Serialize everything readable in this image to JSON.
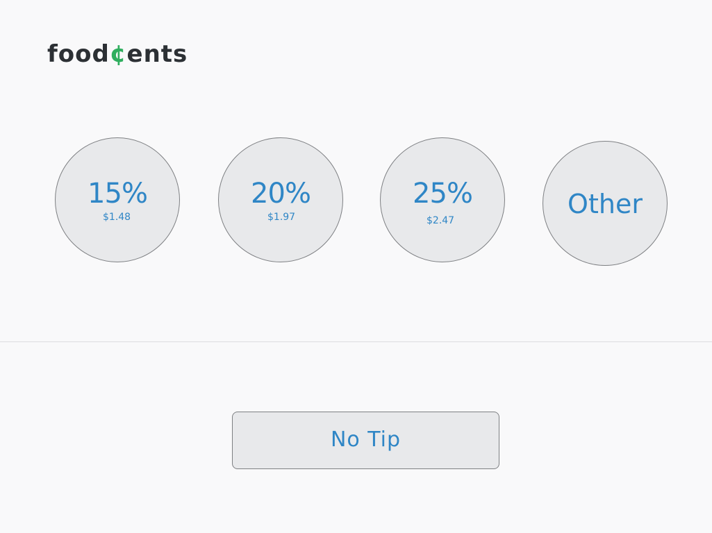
{
  "brand": {
    "name_prefix": "food",
    "name_cent": "¢",
    "name_suffix": "ents",
    "text_color": "#2c3034",
    "accent_color": "#2fae5e"
  },
  "tip_options": [
    {
      "percent_label": "15%",
      "amount_label": "$1.48"
    },
    {
      "percent_label": "20%",
      "amount_label": "$1.97"
    },
    {
      "percent_label": "25%",
      "amount_label": "$2.47"
    },
    {
      "percent_label": "Other"
    }
  ],
  "no_tip": {
    "label": "No Tip"
  },
  "colors": {
    "background": "#f9f9fa",
    "button_fill": "#e8e9eb",
    "button_border": "#7d7f82",
    "label_text": "#2f86c6",
    "divider": "#dcdddf"
  }
}
